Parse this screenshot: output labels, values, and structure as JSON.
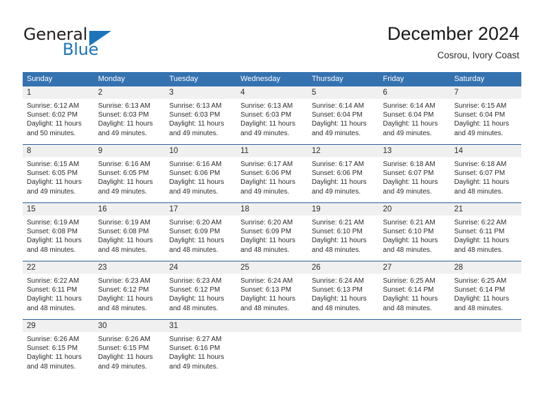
{
  "brand": {
    "name_top": "General",
    "name_bottom": "Blue",
    "accent_color": "#1b75bb"
  },
  "header": {
    "title": "December 2024",
    "subtitle": "Cosrou, Ivory Coast"
  },
  "calendar": {
    "header_background": "#3572b0",
    "day_band_background": "#f0f0f0",
    "row_divider_color": "#2a6099",
    "weekday_headers": [
      "Sunday",
      "Monday",
      "Tuesday",
      "Wednesday",
      "Thursday",
      "Friday",
      "Saturday"
    ],
    "labels": {
      "sunrise_prefix": "Sunrise:",
      "sunset_prefix": "Sunset:",
      "daylight_prefix": "Daylight:"
    },
    "weeks": [
      [
        {
          "day": "1",
          "sunrise": "Sunrise: 6:12 AM",
          "sunset": "Sunset: 6:02 PM",
          "daylight_line1": "Daylight: 11 hours",
          "daylight_line2": "and 50 minutes."
        },
        {
          "day": "2",
          "sunrise": "Sunrise: 6:13 AM",
          "sunset": "Sunset: 6:03 PM",
          "daylight_line1": "Daylight: 11 hours",
          "daylight_line2": "and 49 minutes."
        },
        {
          "day": "3",
          "sunrise": "Sunrise: 6:13 AM",
          "sunset": "Sunset: 6:03 PM",
          "daylight_line1": "Daylight: 11 hours",
          "daylight_line2": "and 49 minutes."
        },
        {
          "day": "4",
          "sunrise": "Sunrise: 6:13 AM",
          "sunset": "Sunset: 6:03 PM",
          "daylight_line1": "Daylight: 11 hours",
          "daylight_line2": "and 49 minutes."
        },
        {
          "day": "5",
          "sunrise": "Sunrise: 6:14 AM",
          "sunset": "Sunset: 6:04 PM",
          "daylight_line1": "Daylight: 11 hours",
          "daylight_line2": "and 49 minutes."
        },
        {
          "day": "6",
          "sunrise": "Sunrise: 6:14 AM",
          "sunset": "Sunset: 6:04 PM",
          "daylight_line1": "Daylight: 11 hours",
          "daylight_line2": "and 49 minutes."
        },
        {
          "day": "7",
          "sunrise": "Sunrise: 6:15 AM",
          "sunset": "Sunset: 6:04 PM",
          "daylight_line1": "Daylight: 11 hours",
          "daylight_line2": "and 49 minutes."
        }
      ],
      [
        {
          "day": "8",
          "sunrise": "Sunrise: 6:15 AM",
          "sunset": "Sunset: 6:05 PM",
          "daylight_line1": "Daylight: 11 hours",
          "daylight_line2": "and 49 minutes."
        },
        {
          "day": "9",
          "sunrise": "Sunrise: 6:16 AM",
          "sunset": "Sunset: 6:05 PM",
          "daylight_line1": "Daylight: 11 hours",
          "daylight_line2": "and 49 minutes."
        },
        {
          "day": "10",
          "sunrise": "Sunrise: 6:16 AM",
          "sunset": "Sunset: 6:06 PM",
          "daylight_line1": "Daylight: 11 hours",
          "daylight_line2": "and 49 minutes."
        },
        {
          "day": "11",
          "sunrise": "Sunrise: 6:17 AM",
          "sunset": "Sunset: 6:06 PM",
          "daylight_line1": "Daylight: 11 hours",
          "daylight_line2": "and 49 minutes."
        },
        {
          "day": "12",
          "sunrise": "Sunrise: 6:17 AM",
          "sunset": "Sunset: 6:06 PM",
          "daylight_line1": "Daylight: 11 hours",
          "daylight_line2": "and 49 minutes."
        },
        {
          "day": "13",
          "sunrise": "Sunrise: 6:18 AM",
          "sunset": "Sunset: 6:07 PM",
          "daylight_line1": "Daylight: 11 hours",
          "daylight_line2": "and 49 minutes."
        },
        {
          "day": "14",
          "sunrise": "Sunrise: 6:18 AM",
          "sunset": "Sunset: 6:07 PM",
          "daylight_line1": "Daylight: 11 hours",
          "daylight_line2": "and 48 minutes."
        }
      ],
      [
        {
          "day": "15",
          "sunrise": "Sunrise: 6:19 AM",
          "sunset": "Sunset: 6:08 PM",
          "daylight_line1": "Daylight: 11 hours",
          "daylight_line2": "and 48 minutes."
        },
        {
          "day": "16",
          "sunrise": "Sunrise: 6:19 AM",
          "sunset": "Sunset: 6:08 PM",
          "daylight_line1": "Daylight: 11 hours",
          "daylight_line2": "and 48 minutes."
        },
        {
          "day": "17",
          "sunrise": "Sunrise: 6:20 AM",
          "sunset": "Sunset: 6:09 PM",
          "daylight_line1": "Daylight: 11 hours",
          "daylight_line2": "and 48 minutes."
        },
        {
          "day": "18",
          "sunrise": "Sunrise: 6:20 AM",
          "sunset": "Sunset: 6:09 PM",
          "daylight_line1": "Daylight: 11 hours",
          "daylight_line2": "and 48 minutes."
        },
        {
          "day": "19",
          "sunrise": "Sunrise: 6:21 AM",
          "sunset": "Sunset: 6:10 PM",
          "daylight_line1": "Daylight: 11 hours",
          "daylight_line2": "and 48 minutes."
        },
        {
          "day": "20",
          "sunrise": "Sunrise: 6:21 AM",
          "sunset": "Sunset: 6:10 PM",
          "daylight_line1": "Daylight: 11 hours",
          "daylight_line2": "and 48 minutes."
        },
        {
          "day": "21",
          "sunrise": "Sunrise: 6:22 AM",
          "sunset": "Sunset: 6:11 PM",
          "daylight_line1": "Daylight: 11 hours",
          "daylight_line2": "and 48 minutes."
        }
      ],
      [
        {
          "day": "22",
          "sunrise": "Sunrise: 6:22 AM",
          "sunset": "Sunset: 6:11 PM",
          "daylight_line1": "Daylight: 11 hours",
          "daylight_line2": "and 48 minutes."
        },
        {
          "day": "23",
          "sunrise": "Sunrise: 6:23 AM",
          "sunset": "Sunset: 6:12 PM",
          "daylight_line1": "Daylight: 11 hours",
          "daylight_line2": "and 48 minutes."
        },
        {
          "day": "24",
          "sunrise": "Sunrise: 6:23 AM",
          "sunset": "Sunset: 6:12 PM",
          "daylight_line1": "Daylight: 11 hours",
          "daylight_line2": "and 48 minutes."
        },
        {
          "day": "25",
          "sunrise": "Sunrise: 6:24 AM",
          "sunset": "Sunset: 6:13 PM",
          "daylight_line1": "Daylight: 11 hours",
          "daylight_line2": "and 48 minutes."
        },
        {
          "day": "26",
          "sunrise": "Sunrise: 6:24 AM",
          "sunset": "Sunset: 6:13 PM",
          "daylight_line1": "Daylight: 11 hours",
          "daylight_line2": "and 48 minutes."
        },
        {
          "day": "27",
          "sunrise": "Sunrise: 6:25 AM",
          "sunset": "Sunset: 6:14 PM",
          "daylight_line1": "Daylight: 11 hours",
          "daylight_line2": "and 48 minutes."
        },
        {
          "day": "28",
          "sunrise": "Sunrise: 6:25 AM",
          "sunset": "Sunset: 6:14 PM",
          "daylight_line1": "Daylight: 11 hours",
          "daylight_line2": "and 48 minutes."
        }
      ],
      [
        {
          "day": "29",
          "sunrise": "Sunrise: 6:26 AM",
          "sunset": "Sunset: 6:15 PM",
          "daylight_line1": "Daylight: 11 hours",
          "daylight_line2": "and 48 minutes."
        },
        {
          "day": "30",
          "sunrise": "Sunrise: 6:26 AM",
          "sunset": "Sunset: 6:15 PM",
          "daylight_line1": "Daylight: 11 hours",
          "daylight_line2": "and 49 minutes."
        },
        {
          "day": "31",
          "sunrise": "Sunrise: 6:27 AM",
          "sunset": "Sunset: 6:16 PM",
          "daylight_line1": "Daylight: 11 hours",
          "daylight_line2": "and 49 minutes."
        },
        {
          "day": "",
          "sunrise": "",
          "sunset": "",
          "daylight_line1": "",
          "daylight_line2": ""
        },
        {
          "day": "",
          "sunrise": "",
          "sunset": "",
          "daylight_line1": "",
          "daylight_line2": ""
        },
        {
          "day": "",
          "sunrise": "",
          "sunset": "",
          "daylight_line1": "",
          "daylight_line2": ""
        },
        {
          "day": "",
          "sunrise": "",
          "sunset": "",
          "daylight_line1": "",
          "daylight_line2": ""
        }
      ]
    ]
  }
}
